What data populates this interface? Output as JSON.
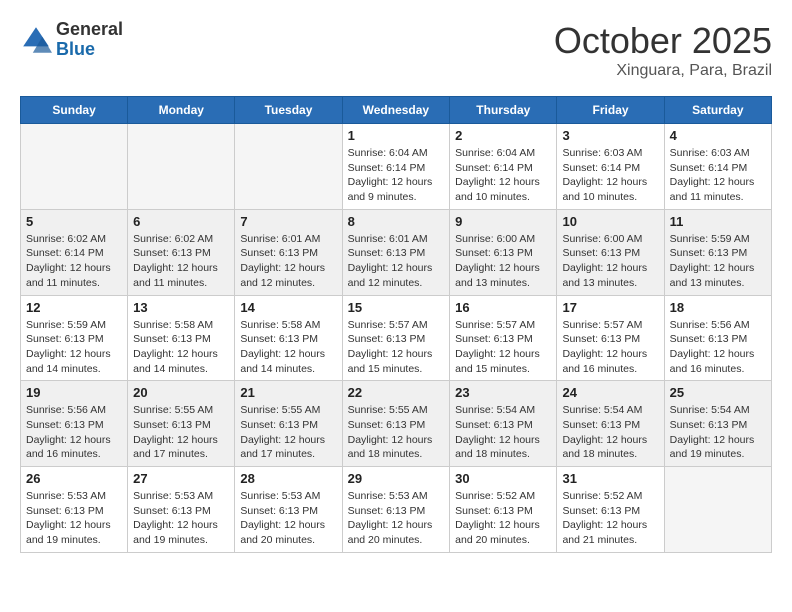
{
  "header": {
    "logo_general": "General",
    "logo_blue": "Blue",
    "month": "October 2025",
    "location": "Xinguara, Para, Brazil"
  },
  "days_of_week": [
    "Sunday",
    "Monday",
    "Tuesday",
    "Wednesday",
    "Thursday",
    "Friday",
    "Saturday"
  ],
  "weeks": [
    [
      {
        "num": "",
        "info": ""
      },
      {
        "num": "",
        "info": ""
      },
      {
        "num": "",
        "info": ""
      },
      {
        "num": "1",
        "info": "Sunrise: 6:04 AM\nSunset: 6:14 PM\nDaylight: 12 hours\nand 9 minutes."
      },
      {
        "num": "2",
        "info": "Sunrise: 6:04 AM\nSunset: 6:14 PM\nDaylight: 12 hours\nand 10 minutes."
      },
      {
        "num": "3",
        "info": "Sunrise: 6:03 AM\nSunset: 6:14 PM\nDaylight: 12 hours\nand 10 minutes."
      },
      {
        "num": "4",
        "info": "Sunrise: 6:03 AM\nSunset: 6:14 PM\nDaylight: 12 hours\nand 11 minutes."
      }
    ],
    [
      {
        "num": "5",
        "info": "Sunrise: 6:02 AM\nSunset: 6:14 PM\nDaylight: 12 hours\nand 11 minutes."
      },
      {
        "num": "6",
        "info": "Sunrise: 6:02 AM\nSunset: 6:13 PM\nDaylight: 12 hours\nand 11 minutes."
      },
      {
        "num": "7",
        "info": "Sunrise: 6:01 AM\nSunset: 6:13 PM\nDaylight: 12 hours\nand 12 minutes."
      },
      {
        "num": "8",
        "info": "Sunrise: 6:01 AM\nSunset: 6:13 PM\nDaylight: 12 hours\nand 12 minutes."
      },
      {
        "num": "9",
        "info": "Sunrise: 6:00 AM\nSunset: 6:13 PM\nDaylight: 12 hours\nand 13 minutes."
      },
      {
        "num": "10",
        "info": "Sunrise: 6:00 AM\nSunset: 6:13 PM\nDaylight: 12 hours\nand 13 minutes."
      },
      {
        "num": "11",
        "info": "Sunrise: 5:59 AM\nSunset: 6:13 PM\nDaylight: 12 hours\nand 13 minutes."
      }
    ],
    [
      {
        "num": "12",
        "info": "Sunrise: 5:59 AM\nSunset: 6:13 PM\nDaylight: 12 hours\nand 14 minutes."
      },
      {
        "num": "13",
        "info": "Sunrise: 5:58 AM\nSunset: 6:13 PM\nDaylight: 12 hours\nand 14 minutes."
      },
      {
        "num": "14",
        "info": "Sunrise: 5:58 AM\nSunset: 6:13 PM\nDaylight: 12 hours\nand 14 minutes."
      },
      {
        "num": "15",
        "info": "Sunrise: 5:57 AM\nSunset: 6:13 PM\nDaylight: 12 hours\nand 15 minutes."
      },
      {
        "num": "16",
        "info": "Sunrise: 5:57 AM\nSunset: 6:13 PM\nDaylight: 12 hours\nand 15 minutes."
      },
      {
        "num": "17",
        "info": "Sunrise: 5:57 AM\nSunset: 6:13 PM\nDaylight: 12 hours\nand 16 minutes."
      },
      {
        "num": "18",
        "info": "Sunrise: 5:56 AM\nSunset: 6:13 PM\nDaylight: 12 hours\nand 16 minutes."
      }
    ],
    [
      {
        "num": "19",
        "info": "Sunrise: 5:56 AM\nSunset: 6:13 PM\nDaylight: 12 hours\nand 16 minutes."
      },
      {
        "num": "20",
        "info": "Sunrise: 5:55 AM\nSunset: 6:13 PM\nDaylight: 12 hours\nand 17 minutes."
      },
      {
        "num": "21",
        "info": "Sunrise: 5:55 AM\nSunset: 6:13 PM\nDaylight: 12 hours\nand 17 minutes."
      },
      {
        "num": "22",
        "info": "Sunrise: 5:55 AM\nSunset: 6:13 PM\nDaylight: 12 hours\nand 18 minutes."
      },
      {
        "num": "23",
        "info": "Sunrise: 5:54 AM\nSunset: 6:13 PM\nDaylight: 12 hours\nand 18 minutes."
      },
      {
        "num": "24",
        "info": "Sunrise: 5:54 AM\nSunset: 6:13 PM\nDaylight: 12 hours\nand 18 minutes."
      },
      {
        "num": "25",
        "info": "Sunrise: 5:54 AM\nSunset: 6:13 PM\nDaylight: 12 hours\nand 19 minutes."
      }
    ],
    [
      {
        "num": "26",
        "info": "Sunrise: 5:53 AM\nSunset: 6:13 PM\nDaylight: 12 hours\nand 19 minutes."
      },
      {
        "num": "27",
        "info": "Sunrise: 5:53 AM\nSunset: 6:13 PM\nDaylight: 12 hours\nand 19 minutes."
      },
      {
        "num": "28",
        "info": "Sunrise: 5:53 AM\nSunset: 6:13 PM\nDaylight: 12 hours\nand 20 minutes."
      },
      {
        "num": "29",
        "info": "Sunrise: 5:53 AM\nSunset: 6:13 PM\nDaylight: 12 hours\nand 20 minutes."
      },
      {
        "num": "30",
        "info": "Sunrise: 5:52 AM\nSunset: 6:13 PM\nDaylight: 12 hours\nand 20 minutes."
      },
      {
        "num": "31",
        "info": "Sunrise: 5:52 AM\nSunset: 6:13 PM\nDaylight: 12 hours\nand 21 minutes."
      },
      {
        "num": "",
        "info": ""
      }
    ]
  ]
}
